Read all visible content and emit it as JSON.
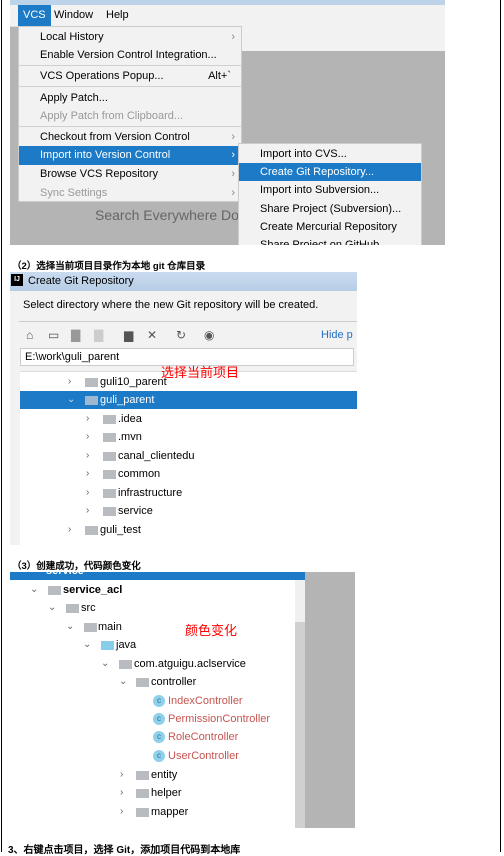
{
  "section1": {
    "menubar": [
      "VCS",
      "Window",
      "Help"
    ],
    "vcs_menu": [
      {
        "label": "Local History",
        "submenu": true
      },
      {
        "label": "Enable Version Control Integration...",
        "submenu": false
      },
      {
        "label": "VCS Operations Popup...",
        "shortcut": "Alt+`"
      },
      {
        "label": "Apply Patch..."
      },
      {
        "label": "Apply Patch from Clipboard...",
        "disabled": true
      },
      {
        "label": "Checkout from Version Control",
        "submenu": true
      },
      {
        "label": "Import into Version Control",
        "submenu": true,
        "selected": true
      },
      {
        "label": "Browse VCS Repository",
        "submenu": true
      },
      {
        "label": "Sync Settings",
        "submenu": true,
        "disabled": true
      }
    ],
    "import_submenu": [
      "Import into CVS...",
      "Create Git Repository...",
      "Import into Subversion...",
      "Share Project (Subversion)...",
      "Create Mercurial Repository",
      "Share Project on GitHub"
    ],
    "selected_submenu_item": "Create Git Repository...",
    "search_hint": "Search Everywhere Do"
  },
  "caption2": "（2）选择当前项目目录作为本地 git 仓库目录",
  "dialog": {
    "title": "Create Git Repository",
    "instruction": "Select directory where the new Git repository will be created.",
    "hide_link": "Hide p",
    "path": "E:\\work\\guli_parent",
    "annotation": "选择当前项目",
    "tree": [
      {
        "label": "guli10_parent",
        "level": 0,
        "expanded": false
      },
      {
        "label": "guli_parent",
        "level": 0,
        "expanded": true,
        "selected": true
      },
      {
        "label": ".idea",
        "level": 1
      },
      {
        "label": ".mvn",
        "level": 1
      },
      {
        "label": "canal_clientedu",
        "level": 1
      },
      {
        "label": "common",
        "level": 1
      },
      {
        "label": "infrastructure",
        "level": 1
      },
      {
        "label": "service",
        "level": 1
      },
      {
        "label": "guli_test",
        "level": 0
      }
    ]
  },
  "caption3": "（3）创建成功，代码颜色变化",
  "project": {
    "annotation": "颜色变化",
    "top_row": "service",
    "tree": [
      {
        "label": "service_acl",
        "level": 0,
        "type": "module"
      },
      {
        "label": "src",
        "level": 1,
        "type": "folder"
      },
      {
        "label": "main",
        "level": 2,
        "type": "folder"
      },
      {
        "label": "java",
        "level": 3,
        "type": "source"
      },
      {
        "label": "com.atguigu.aclservice",
        "level": 4,
        "type": "package"
      },
      {
        "label": "controller",
        "level": 5,
        "type": "package"
      },
      {
        "label": "IndexController",
        "level": 6,
        "type": "class"
      },
      {
        "label": "PermissionController",
        "level": 6,
        "type": "class"
      },
      {
        "label": "RoleController",
        "level": 6,
        "type": "class"
      },
      {
        "label": "UserController",
        "level": 6,
        "type": "class"
      },
      {
        "label": "entity",
        "level": 5,
        "type": "package",
        "collapsed": true
      },
      {
        "label": "helper",
        "level": 5,
        "type": "package",
        "collapsed": true
      },
      {
        "label": "mapper",
        "level": 5,
        "type": "package",
        "collapsed": true
      }
    ],
    "changed_color": "#c75450"
  },
  "caption4": "3、右键点击项目，选择 Git，添加项目代码到本地库",
  "colors": {
    "selection": "#1c7ac6",
    "annotation": "#ff0000"
  }
}
